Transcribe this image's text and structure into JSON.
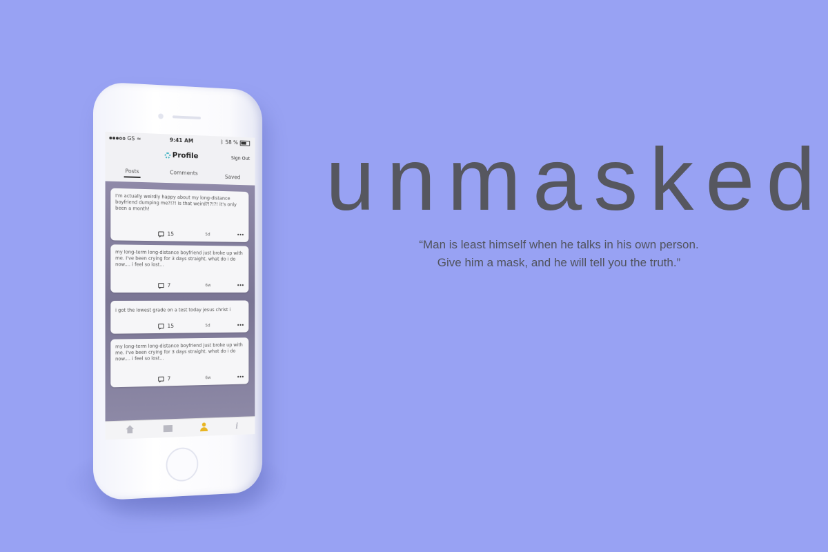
{
  "brand": {
    "title": "unmasked",
    "quote_line1": "“Man is least himself when he talks in his own person.",
    "quote_line2": "Give him a mask, and he will tell you the truth.”"
  },
  "phone": {
    "status": {
      "carrier": "GS",
      "time": "9:41 AM",
      "battery": "58 %",
      "battery_level": 0.58
    },
    "header": {
      "title": "Profile",
      "signout_label": "Sign Out"
    },
    "tabs": [
      "Posts",
      "Comments",
      "Saved"
    ],
    "active_tab": "Posts",
    "posts": [
      {
        "text": "I'm actually weirdly happy about my long-distance boyfriend dumping me?!?! is that weird?!?!?! it's only been a month!",
        "comments": "15",
        "age": "5d"
      },
      {
        "text": "my long-term long-distance boyfriend just broke up with me. I've been crying for 3 days straight. what do i do now.... i feel so lost...",
        "comments": "7",
        "age": "6w"
      },
      {
        "text": "i got the lowest grade on a test today jesus christ i",
        "comments": "15",
        "age": "5d"
      },
      {
        "text": "my long-term long-distance boyfriend just broke up with me. I've been crying for 3 days straight. what do i do now.... i feel so lost...",
        "comments": "7",
        "age": "6w"
      }
    ],
    "more_label": "•••",
    "tabbar": {
      "icons": [
        "home-icon",
        "mail-icon",
        "user-icon",
        "info-icon"
      ],
      "active": "user-icon",
      "info_glyph": "i"
    },
    "colors": {
      "accent": "#e8b524",
      "mask": "#3bb0c0",
      "background": "#98a2f3"
    }
  }
}
